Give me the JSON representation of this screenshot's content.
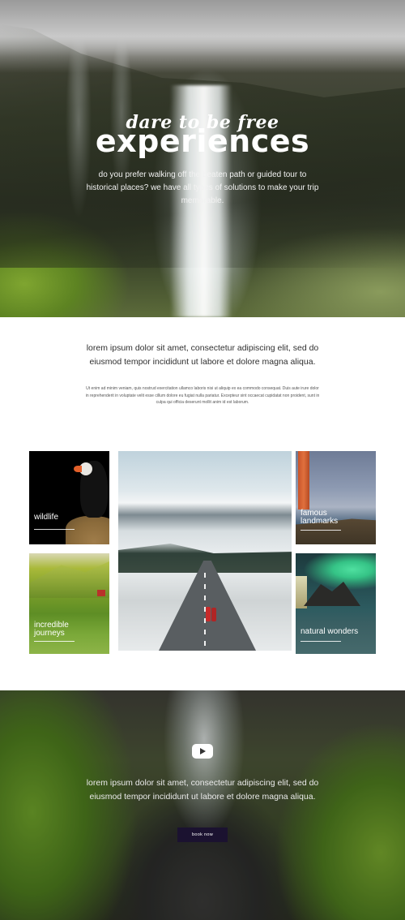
{
  "hero": {
    "script_title": "dare to be free",
    "title": "experiences",
    "subtitle": "do you prefer walking off the beaten path or guided tour to historical places? we have all types of solutions to make your trip memorable."
  },
  "intro": {
    "lead": "lorem ipsum dolor sit amet, consectetur adipiscing elit, sed do eiusmod tempor incididunt ut labore et dolore magna aliqua.",
    "body": "Ut enim ad minim veniam, quis nostrud exercitation ullamco laboris nisi ut aliquip ex ea commodo consequat. Duis aute irure dolor in reprehenderit in voluptate velit esse cillum dolore eu fugiat nulla pariatur. Excepteur sint occaecat cupidatat non proident, sunt in culpa qui officia deserunt mollit anim id est laborum."
  },
  "gallery": {
    "wildlife": "wildlife",
    "landmarks_line1": "famous",
    "landmarks_line2": "landmarks",
    "journeys_line1": "incredible",
    "journeys_line2": "journeys",
    "natural": "natural wonders"
  },
  "promo": {
    "text": "lorem ipsum dolor sit amet, consectetur adipiscing elit, sed do eiusmod tempor incididunt ut labore et dolore magna aliqua.",
    "button_label": "book now",
    "play_icon": "play-icon"
  }
}
